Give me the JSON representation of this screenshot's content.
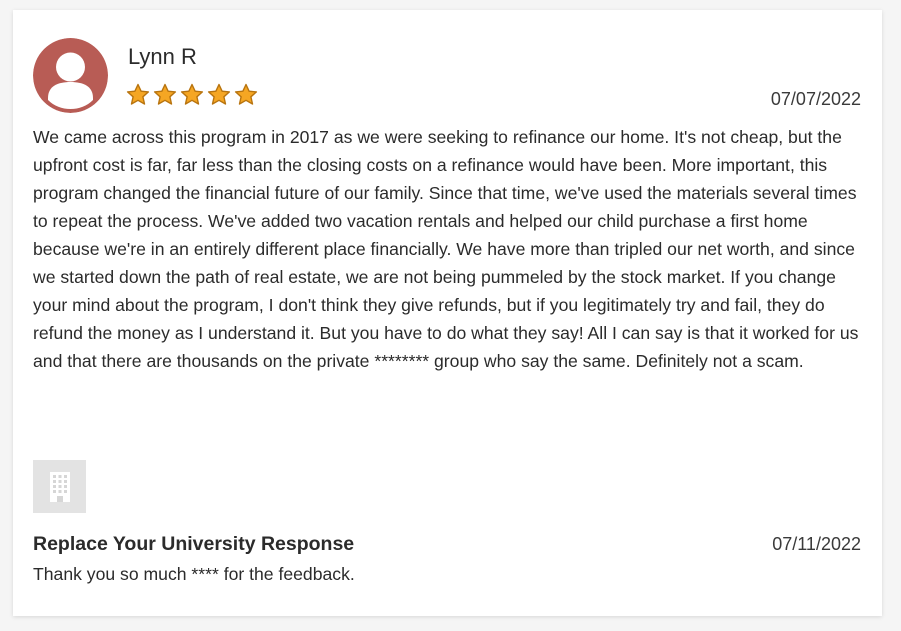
{
  "review": {
    "reviewer_name": "Lynn R",
    "rating": 5,
    "rating_max": 5,
    "date": "07/07/2022",
    "text": "We came across this program in 2017 as we were seeking to refinance our home. It's not cheap, but the upfront cost is far, far less than the closing costs on a refinance would have been. More important, this program changed the financial future of our family. Since that time, we've used the materials several times to repeat the process. We've added two vacation rentals and helped our child purchase a first home because we're in an entirely different place financially. We have more than tripled our net worth, and since we started down the path of real estate, we are not being pummeled by the stock market. If you change your mind about the program, I don't think they give refunds, but if you legitimately try and fail, they do refund the money as I understand it. But you have to do what they say! All I can say is that it worked for us and that there are thousands on the private ******** group who say the same. Definitely not a scam.",
    "avatar_icon": "user-avatar-icon",
    "avatar_color": "#b85c55",
    "star_color": "#f5a623"
  },
  "response": {
    "title": "Replace Your University Response",
    "date": "07/11/2022",
    "text": "Thank you so much **** for the feedback.",
    "logo_icon": "building-icon",
    "logo_bg_color": "#e3e3e3"
  }
}
